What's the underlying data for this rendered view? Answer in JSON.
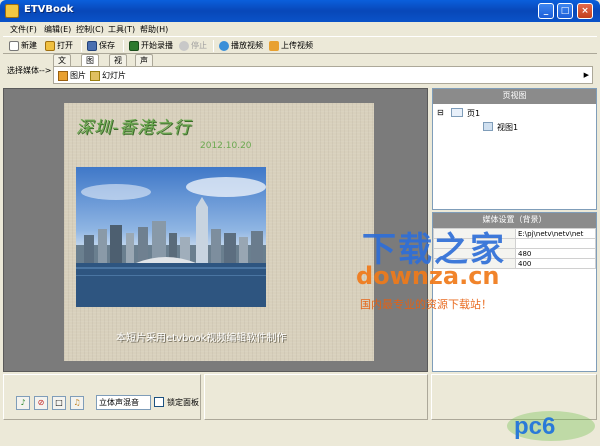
{
  "window": {
    "title": "ETVBook"
  },
  "menu": [
    "文件(F)",
    "编辑(E)",
    "控制(C)",
    "工具(T)",
    "帮助(H)"
  ],
  "toolbar": {
    "new": "新建",
    "open": "打开",
    "save": "保存",
    "record": "开始录播",
    "stop": "停止",
    "play": "播放视频",
    "upload": "上传视频"
  },
  "media": {
    "label": "选择媒体-->",
    "tabs": [
      "文字",
      "图形",
      "视频",
      "声音"
    ],
    "items": [
      "图片",
      "幻灯片"
    ]
  },
  "slide": {
    "title": "深圳-香港之行",
    "date": "2012.10.20",
    "caption": "本短片采用etvbook视频编辑软件制作"
  },
  "pageview": {
    "header": "页视图",
    "page": "页1",
    "view": "视图1"
  },
  "mediaset": {
    "header": "媒体设置（背景）",
    "rows": [
      {
        "key": "",
        "value": "E:\\pj\\netv\\netv\\net"
      },
      {
        "key": "",
        "value": ""
      },
      {
        "key": "",
        "value": "480"
      },
      {
        "key": "",
        "value": "400"
      }
    ]
  },
  "bottom": {
    "audio_mode": "立体声混音",
    "lock_label": "锁定面板"
  },
  "watermark": {
    "line1": "下载之家",
    "line2": "downza.cn",
    "line3": "国内最专业的资源下载站！",
    "logo": "pc6"
  },
  "colors": {
    "titlebar": "#0a52c8",
    "slide_title": "#6aa84f",
    "canvas_bg": "#7b7b7b",
    "watermark_blue": "#2f6fd8",
    "watermark_orange": "#f07a1a"
  }
}
